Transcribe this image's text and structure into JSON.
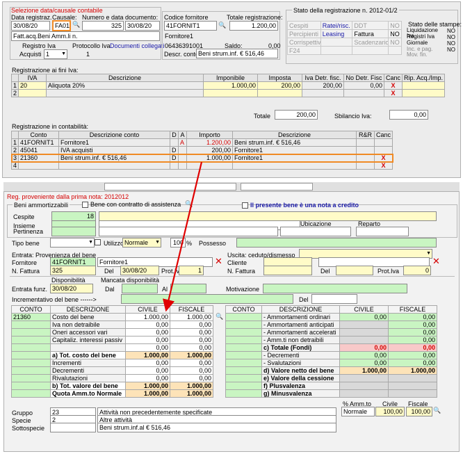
{
  "top": {
    "group_title": "Selezione data/causale contabile",
    "data_reg_label": "Data registraz.",
    "data_reg": "30/08/20",
    "causale_label": "Causale:",
    "causale": "FA01",
    "numero_label": "Numero e data documento:",
    "numero": "325",
    "data_doc": "30/08/20",
    "descr": "Fatt.acq.Beni Amm.li n.",
    "registro_label": "Registro Iva",
    "protocollo_label": "Protocollo Iva",
    "doc_collegati": "Documenti collegati",
    "acquisti_label": "Acquisti",
    "acquisti_val": "1",
    "protocollo_val": "1",
    "fornitore_label": "Codice fornitore",
    "fornitore": "41FORNIT1",
    "totale_label": "Totale registrazione:",
    "totale": "1.200,00",
    "fornitore_nome": "Fornitore1",
    "piva": "06436391001",
    "saldo_label": "Saldo:",
    "saldo": "0,00",
    "descr_conto_label": "Descr. conto",
    "descr_conto": "Beni strum.inf. € 516,46"
  },
  "stato": {
    "title": "Stato della registrazione n. 2012-01/2",
    "rows": [
      [
        "Cespiti",
        "Ratei/risc.",
        "DDT",
        "NO"
      ],
      [
        "Percipienti",
        "Leasing",
        "Fattura",
        "NO"
      ],
      [
        "Corrispettivi",
        "",
        "Scadenzario",
        "NO"
      ],
      [
        "F24",
        "",
        "",
        ""
      ]
    ],
    "stampe_title": "Stato delle stampe:",
    "stampe": [
      [
        "Liquidazione Iva",
        "NO"
      ],
      [
        "Registri Iva",
        "NO"
      ],
      [
        "Giornale",
        "NO"
      ],
      [
        "Inc. e pag. Mov. fin.",
        "NO"
      ]
    ]
  },
  "iva": {
    "title": "Registrazione ai fini Iva:",
    "headers": [
      "IVA",
      "Descrizione",
      "Imponibile",
      "Imposta",
      "Iva Detr. fisc.",
      "No Detr. Fisc",
      "Canc",
      "Rip. Acq./Imp."
    ],
    "rows": [
      {
        "n": "1",
        "iva": "20",
        "descr": "Aliquota 20%",
        "imponibile": "1.000,00",
        "imposta": "200,00",
        "detr": "200,00",
        "nodetr": "0,00",
        "canc": "X"
      },
      {
        "n": "2",
        "iva": "",
        "descr": "",
        "imponibile": "",
        "imposta": "",
        "detr": "",
        "nodetr": "",
        "canc": "X"
      }
    ],
    "totale_label": "Totale",
    "totale": "200,00",
    "sbilancio_label": "Sbilancio Iva:",
    "sbilancio": "0,00"
  },
  "conta": {
    "title": "Registrazione in contabilità:",
    "headers": [
      "Conto",
      "Descrizione conto",
      "D",
      "A",
      "Importo",
      "Descrizione",
      "R&R",
      "Canc"
    ],
    "rows": [
      {
        "n": "1",
        "conto": "41FORNIT1",
        "descr": "Fornitore1",
        "d": "",
        "a": "A",
        "importo": "1.200,00",
        "descr2": "Beni strum.inf. € 516,46",
        "canc": ""
      },
      {
        "n": "2",
        "conto": "45041",
        "descr": "IVA acquisti",
        "d": "D",
        "a": "",
        "importo": "200,00",
        "descr2": "Fornitore1",
        "canc": ""
      },
      {
        "n": "3",
        "conto": "21360",
        "descr": "Beni strum.inf. € 516,46",
        "d": "D",
        "a": "",
        "importo": "1.000,00",
        "descr2": "Fornitore1",
        "canc": "X"
      },
      {
        "n": "4",
        "conto": "",
        "descr": "",
        "d": "",
        "a": "",
        "importo": "",
        "descr2": "",
        "canc": "X"
      }
    ]
  },
  "cespite": {
    "provenienza": "Reg. proveniente dalla prima nota: 2012012",
    "tab_label": "Beni ammortizzabili",
    "contratto_label": "Bene con contratto di assistenza",
    "nota_credito": "Il presente bene è una nota a credito",
    "cespite_label": "Cespite",
    "cespite": "18",
    "insieme_label": "Insieme",
    "pertinenza_label": "Pertinenza",
    "ubicazione_label": "Ubicazione",
    "reparto_label": "Reparto",
    "tipo_bene_label": "Tipo bene",
    "utilizzo_label": "Utilizzo",
    "utilizzo": "Normale",
    "percentuale": "100",
    "pct_sign": "%",
    "possesso_label": "Possesso",
    "entrata_label": "Entrata: Provenienza del bene",
    "fornitore_label": "Fornitore",
    "fornitore": "41FORNIT1",
    "fornitore_nome": "Fornitore1",
    "nfattura_label": "N. Fattura",
    "nfattura": "325",
    "del_label": "Del",
    "del": "30/08/20",
    "protiva_label": "Prot.Iva",
    "protiva": "1",
    "uscita_label": "Uscita: ceduto/dismesso",
    "cliente_label": "Cliente",
    "u_protiva": "0",
    "disponibilita_label": "Disponibilità",
    "mancata_label": "Mancata disponibilità",
    "entrata_funz_label": "Entrata funz.",
    "entrata_funz": "30/08/20",
    "dal_label": "Dal",
    "al_label": "Al",
    "motivazione_label": "Motivazione",
    "incrementativo_label": "Incrementativo del bene ------>",
    "del2_label": "Del"
  },
  "left_table": {
    "headers": [
      "CONTO",
      "DESCRIZIONE",
      "CIVILE",
      "FISCALE"
    ],
    "conto": "21360",
    "rows": [
      {
        "d": "Costo del bene",
        "c": "1.000,00",
        "f": "1.000,00",
        "s": ""
      },
      {
        "d": "Iva non detraibile",
        "c": "0,00",
        "f": "0,00",
        "s": ""
      },
      {
        "d": "Oneri accessori vari",
        "c": "0,00",
        "f": "0,00",
        "s": ""
      },
      {
        "d": "Capitaliz. interessi passiv",
        "c": "0,00",
        "f": "0,00",
        "s": ""
      },
      {
        "d": "",
        "c": "0,00",
        "f": "0,00",
        "s": ""
      },
      {
        "d": "a) Tot. costo del bene",
        "c": "1.000,00",
        "f": "1.000,00",
        "s": "t"
      },
      {
        "d": "Incrementi",
        "c": "0,00",
        "f": "0,00",
        "s": ""
      },
      {
        "d": "Decrementi",
        "c": "0,00",
        "f": "0,00",
        "s": ""
      },
      {
        "d": "Rivalutazioni",
        "c": "0,00",
        "f": "0,00",
        "s": ""
      },
      {
        "d": "b) Tot. valore del bene",
        "c": "1.000,00",
        "f": "1.000,00",
        "s": "t"
      },
      {
        "d": "Quota Amm.to Normale",
        "c": "1.000,00",
        "f": "1.000,00",
        "s": "t"
      }
    ]
  },
  "right_table": {
    "headers": [
      "CONTO",
      "DESCRIZIONE",
      "CIVILE",
      "FISCALE"
    ],
    "rows": [
      {
        "d": "- Ammortamenti ordinari",
        "c": "0,00",
        "f": "0,00",
        "s": ""
      },
      {
        "d": "- Ammortamenti anticipati",
        "c": "",
        "f": "0,00",
        "s": ""
      },
      {
        "d": "- Ammortamenti accelerati",
        "c": "",
        "f": "0,00",
        "s": ""
      },
      {
        "d": "- Amm.ti non detraibili",
        "c": "",
        "f": "0,00",
        "s": ""
      },
      {
        "d": "c) Totale (Fondi)",
        "c": "0,00",
        "f": "0,00",
        "s": "r"
      },
      {
        "d": "- Decrementi",
        "c": "0,00",
        "f": "0,00",
        "s": ""
      },
      {
        "d": "- Svalutazioni",
        "c": "0,00",
        "f": "0,00",
        "s": ""
      },
      {
        "d": "d) Valore netto del bene",
        "c": "1.000,00",
        "f": "1.000,00",
        "s": "t"
      },
      {
        "d": "e) Valore della cessione",
        "c": "",
        "f": "",
        "s": "e"
      },
      {
        "d": "f) Plusvalenza",
        "c": "",
        "f": "",
        "s": "e"
      },
      {
        "d": "g) Minusvalenza",
        "c": "",
        "f": "",
        "s": "e"
      }
    ]
  },
  "footer": {
    "gruppo_label": "Gruppo",
    "gruppo": "23",
    "gruppo_descr": "Attività non precedentemente specificate",
    "specie_label": "Specie",
    "specie": "2",
    "specie_descr": "Altre attività",
    "sottospecie_label": "Sottospecie",
    "sottospecie_descr": "Beni strum.inf.al € 516,46",
    "amm_label": "% Amm.to",
    "civile_label": "Civile",
    "fiscale_label": "Fiscale",
    "amm_tipo": "Normale",
    "amm_civile": "100,00",
    "amm_fiscale": "100,00"
  }
}
